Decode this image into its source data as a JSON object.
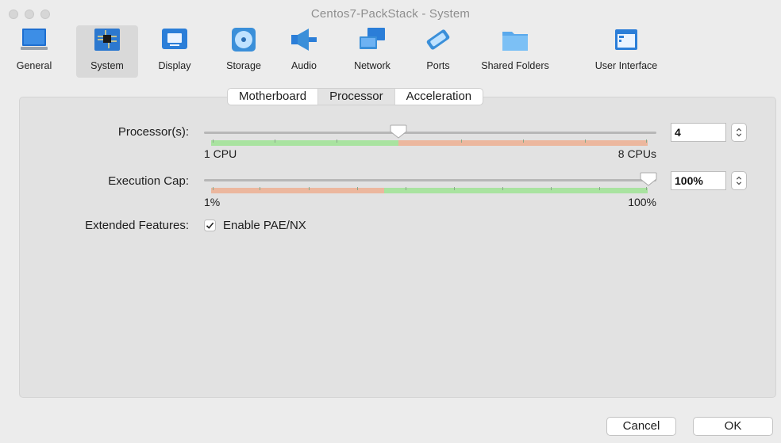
{
  "window": {
    "title": "Centos7-PackStack - System"
  },
  "toolbar": {
    "items": [
      {
        "label": "General",
        "icon": "general-icon"
      },
      {
        "label": "System",
        "icon": "system-icon",
        "selected": true
      },
      {
        "label": "Display",
        "icon": "display-icon"
      },
      {
        "label": "Storage",
        "icon": "storage-icon"
      },
      {
        "label": "Audio",
        "icon": "audio-icon"
      },
      {
        "label": "Network",
        "icon": "network-icon"
      },
      {
        "label": "Ports",
        "icon": "ports-icon"
      },
      {
        "label": "Shared Folders",
        "icon": "shared-folders-icon"
      },
      {
        "label": "User Interface",
        "icon": "user-interface-icon"
      }
    ]
  },
  "tabs": [
    {
      "label": "Motherboard"
    },
    {
      "label": "Processor",
      "active": true
    },
    {
      "label": "Acceleration"
    }
  ],
  "processor": {
    "label": "Processor(s):",
    "value": "4",
    "min_label": "1 CPU",
    "max_label": "8 CPUs",
    "recommended_fraction": 0.43,
    "current_fraction": 0.43
  },
  "execution_cap": {
    "label": "Execution Cap:",
    "value": "100%",
    "min_label": "1%",
    "max_label": "100%",
    "current_fraction": 1.0
  },
  "extended": {
    "label": "Extended Features:",
    "checkbox_label": "Enable PAE/NX",
    "checked": true
  },
  "buttons": {
    "cancel": "Cancel",
    "ok": "OK"
  },
  "colors": {
    "good": "#a9e3a0",
    "warn": "#ecb79e",
    "selected_toolbar_bg": "#d9d9d9"
  }
}
